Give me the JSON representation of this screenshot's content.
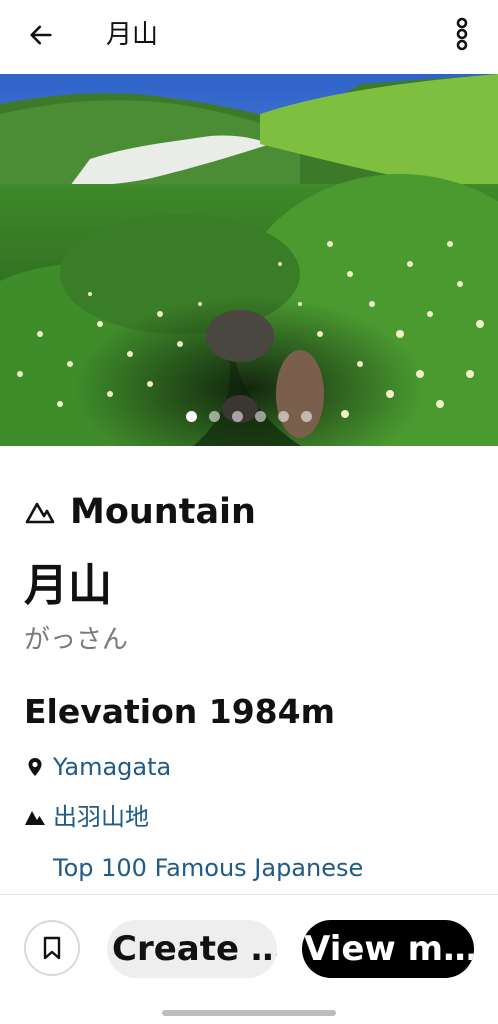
{
  "header": {
    "title": "月山",
    "back_icon": "arrow-left-icon",
    "more_icon": "more-vertical-icon"
  },
  "carousel": {
    "image_description": "photo",
    "slide_count": 6,
    "active_index": 0
  },
  "details": {
    "category": "Mountain",
    "category_icon": "mountain-outline-icon",
    "name": "月山",
    "reading": "がっさん",
    "elevation": "Elevation 1984m",
    "prefecture": "Yamagata",
    "prefecture_icon": "location-pin-icon",
    "range": "出羽山地",
    "range_icon": "mountain-filled-icon",
    "list": "Top 100 Famous Japanese"
  },
  "actions": {
    "bookmark_icon": "bookmark-icon",
    "create_label": "Create …",
    "view_label": "View m…"
  },
  "colors": {
    "link": "#1f5b86",
    "secondary_text": "#7a7a7a",
    "primary_button_bg": "#000000",
    "secondary_button_bg": "#eeeeee"
  }
}
